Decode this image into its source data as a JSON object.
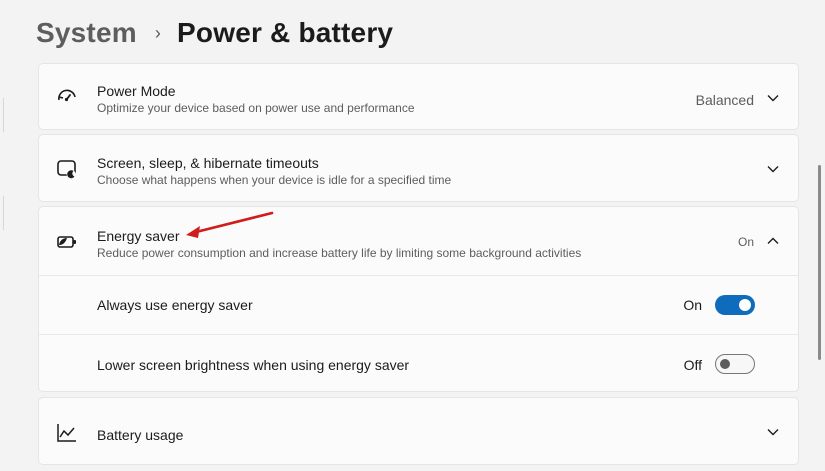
{
  "breadcrumb": {
    "parent": "System",
    "separator": "›",
    "current": "Power & battery"
  },
  "power_mode": {
    "title": "Power Mode",
    "subtitle": "Optimize your device based on power use and performance",
    "value": "Balanced",
    "icon": "power-mode-gauge-icon"
  },
  "screen_sleep": {
    "title": "Screen, sleep, & hibernate timeouts",
    "subtitle": "Choose what happens when your device is idle for a specified time",
    "icon": "screen-sleep-icon"
  },
  "energy_saver": {
    "title": "Energy saver",
    "subtitle": "Reduce power consumption and increase battery life by limiting some background activities",
    "status": "On",
    "expanded": true,
    "icon": "battery-leaf-icon",
    "settings": [
      {
        "label": "Always use energy saver",
        "state_label": "On",
        "on": true
      },
      {
        "label": "Lower screen brightness when using energy saver",
        "state_label": "Off",
        "on": false
      }
    ]
  },
  "battery_usage": {
    "title": "Battery usage",
    "icon": "line-chart-icon"
  },
  "colors": {
    "accent": "#0f6cbd",
    "annotation_arrow": "#d01c1c",
    "background": "#f3f3f3",
    "card": "#fbfbfb"
  }
}
